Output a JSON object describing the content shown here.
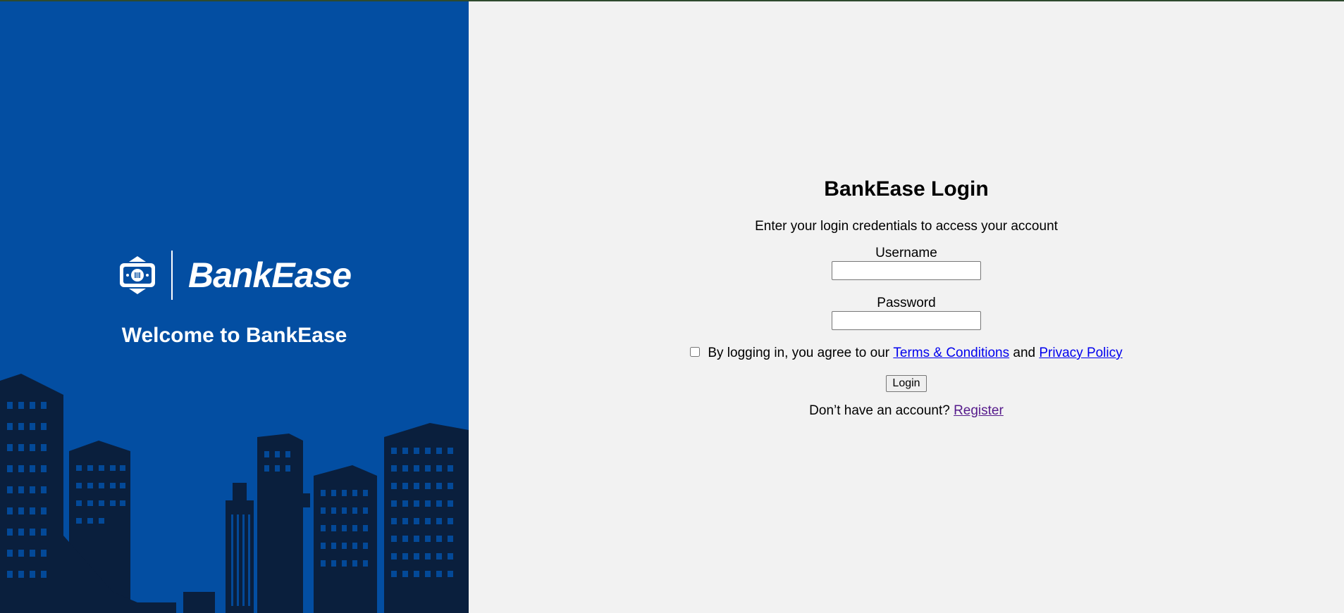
{
  "brand": {
    "name": "BankEase",
    "welcome": "Welcome to BankEase",
    "primary_color": "#034ea2",
    "icon": "atm-card-icon"
  },
  "login": {
    "title": "BankEase Login",
    "subtitle": "Enter your login credentials to access your account",
    "username_label": "Username",
    "username_value": "",
    "password_label": "Password",
    "password_value": "",
    "agree_text": "By logging in, you agree to our",
    "terms_link": "Terms & Conditions",
    "and_text": "and",
    "privacy_link": "Privacy Policy",
    "agree_checked": false,
    "login_button": "Login",
    "no_account_text": "Don’t have an account?",
    "register_link": "Register"
  },
  "colors": {
    "link": "#0000ee",
    "visited_link": "#551a8b",
    "right_background": "#f2f2f2"
  }
}
